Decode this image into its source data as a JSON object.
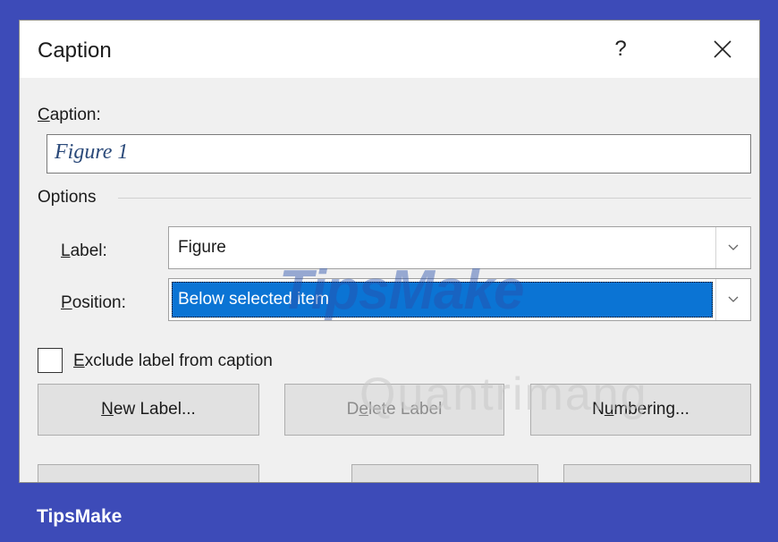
{
  "dialog": {
    "title": "Caption",
    "help_label": "?",
    "caption_label": "Caption:",
    "caption_value": "Figure 1",
    "options_label": "Options",
    "label_label": "Label:",
    "label_value": "Figure",
    "position_label": "Position:",
    "position_value": "Below selected item",
    "exclude_label": "Exclude label from caption",
    "exclude_checked": false,
    "buttons": {
      "new_label": "New Label...",
      "delete_label": "Delete Label",
      "numbering": "Numbering..."
    }
  },
  "watermarks": {
    "brand_overlay": "TipsMake",
    "site_overlay": "Quantrimang"
  },
  "footer": {
    "brand": "TipsMake"
  },
  "colors": {
    "frame": "#3d4bb8",
    "selection": "#0b74d4"
  }
}
